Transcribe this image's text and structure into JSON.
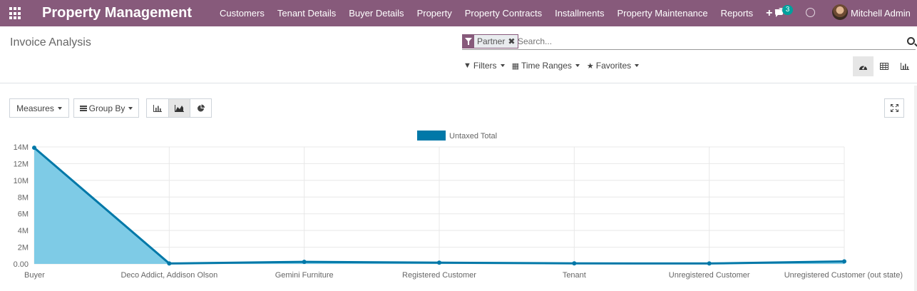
{
  "topbar": {
    "app_title": "Property Management",
    "menu": [
      "Customers",
      "Tenant Details",
      "Buyer Details",
      "Property",
      "Property Contracts",
      "Installments",
      "Property Maintenance",
      "Reports"
    ],
    "plus_icon": "plus-icon",
    "messages_count": "3",
    "user_name": "Mitchell Admin"
  },
  "control_panel": {
    "breadcrumb": "Invoice Analysis",
    "facet_label": "Partner",
    "search_placeholder": "Search...",
    "filters_label": "Filters",
    "time_ranges_label": "Time Ranges",
    "favorites_label": "Favorites",
    "views": [
      "dashboard-icon",
      "pivot-icon",
      "graph-icon"
    ],
    "active_view": "dashboard-icon"
  },
  "toolbar": {
    "measures_label": "Measures",
    "group_by_label": "Group By",
    "chart_modes": [
      "bar-chart-icon",
      "line-chart-icon",
      "pie-chart-icon"
    ],
    "active_mode": "line-chart-icon"
  },
  "chart_data": {
    "type": "area",
    "categories": [
      "Buyer",
      "Deco Addict, Addison Olson",
      "Gemini Furniture",
      "Registered Customer",
      "Tenant",
      "Unregistered Customer",
      "Unregistered Customer (out state)"
    ],
    "series": [
      {
        "name": "Untaxed Total",
        "values": [
          13900000,
          50000,
          250000,
          150000,
          60000,
          50000,
          300000
        ]
      }
    ],
    "ylim": [
      0,
      14000000
    ],
    "yticks": [
      "0.00",
      "2M",
      "4M",
      "6M",
      "8M",
      "10M",
      "12M",
      "14M"
    ],
    "legend": "top-center",
    "grid": true,
    "line_color": "#0078a8",
    "fill_color": "#7ecbe6"
  }
}
